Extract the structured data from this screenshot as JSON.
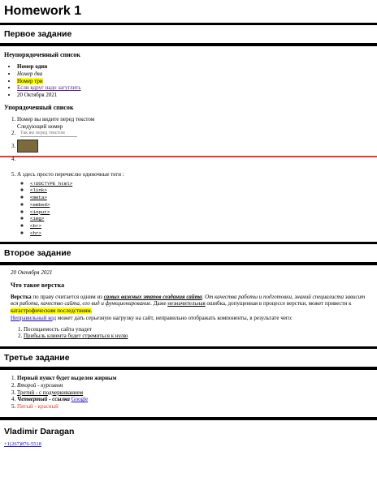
{
  "title": "Homework 1",
  "sections": {
    "first": {
      "title": "Первое задание",
      "unordered": {
        "heading": "Неупорядоченный список",
        "items": [
          "Номер один",
          "Номер два",
          "Номер три",
          "Если вдруг надо загуглить",
          "20 Октября 2021"
        ]
      },
      "ordered": {
        "heading": "Упорядоченный список",
        "item1_line1": "Номер вы видите перед текстом",
        "item1_line2": "Следующий номер",
        "item2_placeholder": "Так же перед текстом",
        "item5_text": "А здесь просто перечислю одиночные теги :",
        "tags": [
          "<!DOCTYPE html>",
          "<link>",
          "<meta>",
          "<embed>",
          "<input>",
          "<img>",
          "<br>",
          "<hr>"
        ]
      }
    },
    "second": {
      "title": "Второе задание",
      "date": "20 Октября 2021",
      "subheading": "Что такое верстка",
      "para_a": "Верстка",
      "para_b": " по праву считается одним из ",
      "para_c": "самых важных этапов создания сайта",
      "para_d": ". От качества работы и подготовки, знаний специалиста зависит вся работа, качество сайта, его вид и функционирование.",
      "para_e": " Даже ",
      "para_f": "незначительная",
      "para_g": " ошибка, допущенная в процессе верстки, может привести к ",
      "para_h": "катастрофическим последствиям.",
      "para_i": "Неправильный код",
      "para_j": " может дать серьезную нагрузку на сайт, неправильно отображать компоненты, в результате чего:",
      "results": [
        "Посещаемость сайта упадет",
        "Прибыль клиента будет стремиться к нулю"
      ]
    },
    "third": {
      "title": "Третье задание",
      "items": {
        "one": "Первый пункт будет выделен жирным",
        "two": "Второй - курсивом",
        "three": "Третий - с подчеркиванием",
        "four_prefix": "Четвертый - ссылка",
        "four_link": "Google",
        "five": "Пятый - красный"
      }
    }
  },
  "footer": {
    "name": "Vladimir Daragan",
    "phone": "+1(267)876-5518"
  }
}
